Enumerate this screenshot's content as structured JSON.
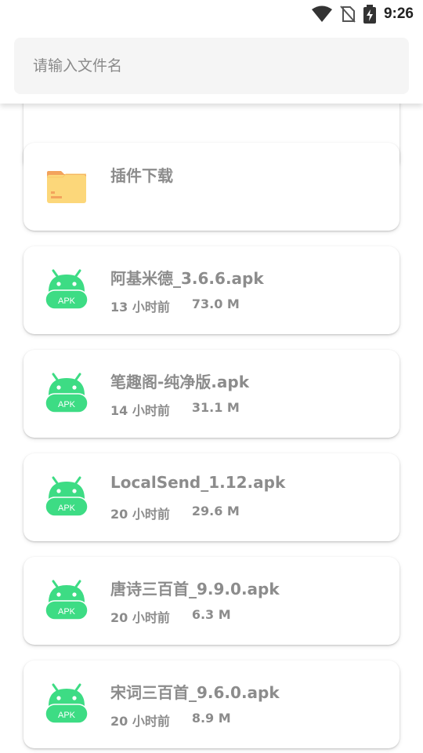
{
  "status_bar": {
    "time": "9:26"
  },
  "search": {
    "placeholder": "请输入文件名",
    "value": ""
  },
  "files": [
    {
      "name": "",
      "time": "",
      "size": "",
      "type": "folder"
    },
    {
      "name": "插件下载",
      "time": "",
      "size": "",
      "type": "folder"
    },
    {
      "name": "阿基米德_3.6.6.apk",
      "time": "13 小时前",
      "size": "73.0 M",
      "type": "apk"
    },
    {
      "name": "笔趣阁-纯净版.apk",
      "time": "14 小时前",
      "size": "31.1 M",
      "type": "apk"
    },
    {
      "name": "LocalSend_1.12.apk",
      "time": "20 小时前",
      "size": "29.6 M",
      "type": "apk"
    },
    {
      "name": "唐诗三百首_9.9.0.apk",
      "time": "20 小时前",
      "size": "6.3 M",
      "type": "apk"
    },
    {
      "name": "宋词三百首_9.6.0.apk",
      "time": "20 小时前",
      "size": "8.9 M",
      "type": "apk"
    }
  ],
  "icons": {
    "apk_label": "APK"
  },
  "colors": {
    "apk_green": "#3ddc84",
    "folder_yellow": "#fcd77a",
    "folder_tab": "#f3a35c",
    "text_gray": "#8c8c8c"
  }
}
